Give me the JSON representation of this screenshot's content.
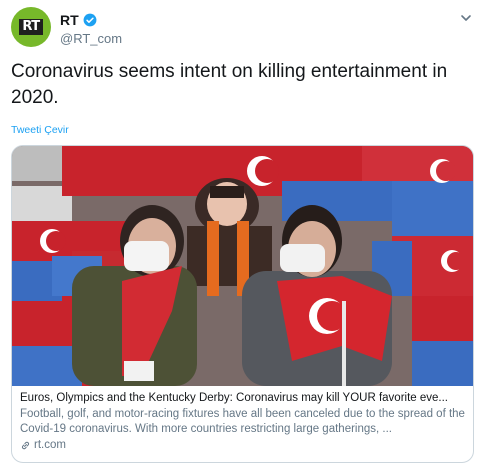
{
  "account": {
    "avatar_text": "RT",
    "name": "RT",
    "handle": "@RT_com"
  },
  "tweet": {
    "text": "Coronavirus seems intent on killing entertainment in 2020.",
    "translate_label": "Tweeti Çevir"
  },
  "card": {
    "title": "Euros, Olympics and the Kentucky Derby: Coronavirus may kill YOUR favorite eve...",
    "description": "Football, golf, and motor-racing fixtures have all been canceled due to the spread of the Covid-19 coronavirus. With more countries restricting large gatherings, ...",
    "domain": "rt.com"
  },
  "icons": {
    "verified": "verified-badge-icon",
    "menu": "chevron-down-icon",
    "link": "link-icon"
  },
  "colors": {
    "accent": "#1da1f2",
    "avatar_bg": "#77b82a",
    "secondary_text": "#657786"
  }
}
